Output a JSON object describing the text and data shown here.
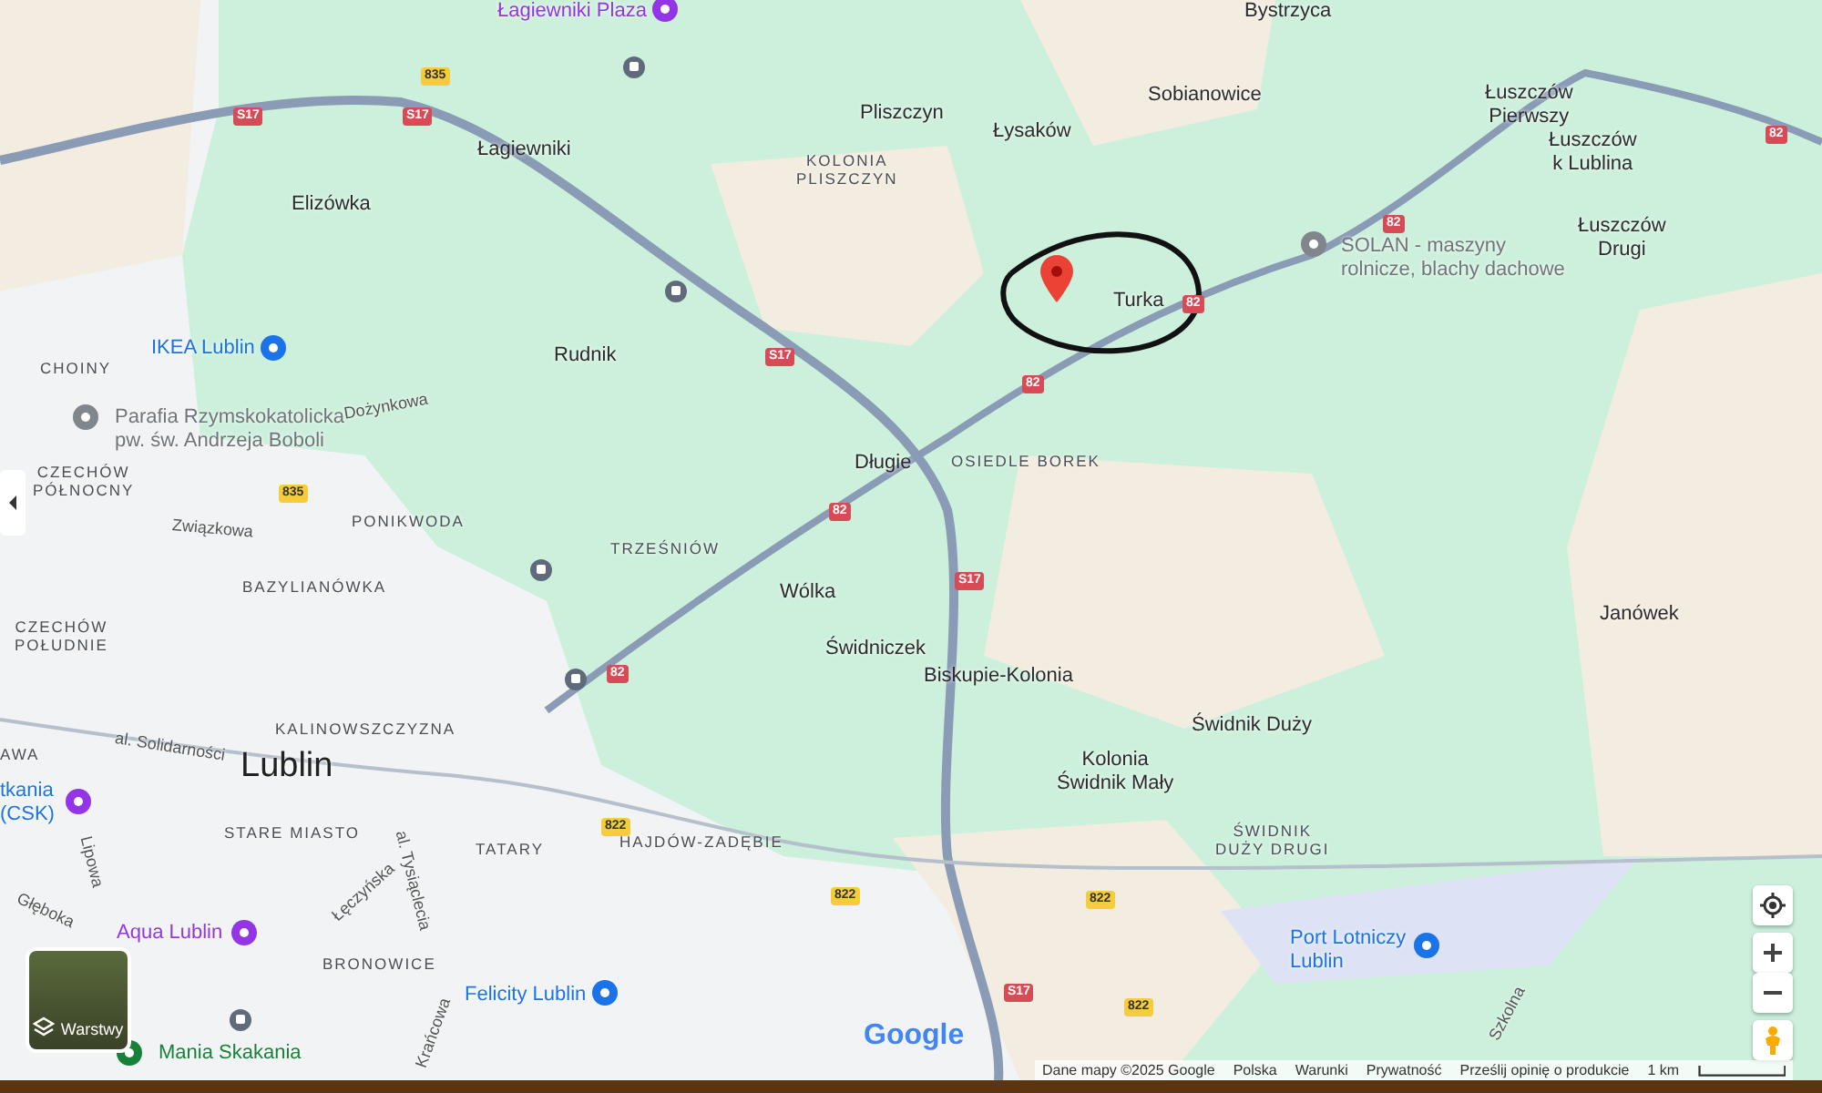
{
  "labels": [
    {
      "text": "Łagiewniki Plaza",
      "kind": "poi",
      "color": "#9334e6"
    },
    {
      "text": "Bystrzyca",
      "kind": "town"
    },
    {
      "text": "Łagiewniki",
      "kind": "town"
    },
    {
      "text": "Pliszczyn",
      "kind": "town"
    },
    {
      "text": "Łysaków",
      "kind": "town"
    },
    {
      "text": "Sobianowice",
      "kind": "town"
    },
    {
      "text": "Łuszczów\nPierwszy",
      "kind": "town"
    },
    {
      "text": "Łuszczów\nk Lublina",
      "kind": "town"
    },
    {
      "text": "KOLONIA\nPLISZCZYN",
      "kind": "district"
    },
    {
      "text": "Elizówka",
      "kind": "town"
    },
    {
      "text": "SOLAN - maszyny\nrolnicze, blachy dachowe",
      "kind": "poi",
      "color": "#70757a"
    },
    {
      "text": "Łuszczów\nDrugi",
      "kind": "town"
    },
    {
      "text": "Turka",
      "kind": "town"
    },
    {
      "text": "IKEA Lublin",
      "kind": "poi",
      "color": "#1a73e8"
    },
    {
      "text": "Rudnik",
      "kind": "town"
    },
    {
      "text": "CHOINY",
      "kind": "district"
    },
    {
      "text": "Parafia Rzymskokatolicka\npw. św. Andrzeja Boboli",
      "kind": "poi",
      "color": "#70757a"
    },
    {
      "text": "Dożynkowa",
      "kind": "street"
    },
    {
      "text": "Długie",
      "kind": "town"
    },
    {
      "text": "OSIEDLE BOREK",
      "kind": "district"
    },
    {
      "text": "CZECHÓW\nPÓŁNOCNY",
      "kind": "district"
    },
    {
      "text": "Związkowa",
      "kind": "street"
    },
    {
      "text": "PONIKWODA",
      "kind": "district"
    },
    {
      "text": "TRZEŚNIÓW",
      "kind": "district"
    },
    {
      "text": "BAZYLIANÓWKA",
      "kind": "district"
    },
    {
      "text": "Wólka",
      "kind": "town"
    },
    {
      "text": "Janówek",
      "kind": "town"
    },
    {
      "text": "CZECHÓW\nPOŁUDNIE",
      "kind": "district"
    },
    {
      "text": "Świdniczek",
      "kind": "town"
    },
    {
      "text": "Biskupie-Kolonia",
      "kind": "town"
    },
    {
      "text": "KALINOWSZCZYZNA",
      "kind": "district"
    },
    {
      "text": "Świdnik Duży",
      "kind": "town"
    },
    {
      "text": "al. Solidarności",
      "kind": "street"
    },
    {
      "text": "AWA",
      "kind": "district"
    },
    {
      "text": "tkania\n(CSK)",
      "kind": "poi",
      "color": "#1a73e8"
    },
    {
      "text": "Lublin",
      "kind": "city"
    },
    {
      "text": "Kolonia\nŚwidnik Mały",
      "kind": "town"
    },
    {
      "text": "STARE MIASTO",
      "kind": "district"
    },
    {
      "text": "al. Tysiąclecia",
      "kind": "street"
    },
    {
      "text": "Lipowa",
      "kind": "street"
    },
    {
      "text": "TATARY",
      "kind": "district"
    },
    {
      "text": "HAJDÓW-ZADĘBIE",
      "kind": "district"
    },
    {
      "text": "ŚWIDNIK\nDUŻY DRUGI",
      "kind": "district"
    },
    {
      "text": "Głęboka",
      "kind": "street"
    },
    {
      "text": "Łęczyńska",
      "kind": "street"
    },
    {
      "text": "Aqua Lublin",
      "kind": "poi",
      "color": "#9334e6"
    },
    {
      "text": "BRONOWICE",
      "kind": "district"
    },
    {
      "text": "Port Lotniczy\nLublin",
      "kind": "poi",
      "color": "#1a73e8"
    },
    {
      "text": "Felicity Lublin",
      "kind": "poi",
      "color": "#1a73e8"
    },
    {
      "text": "Krańcowa",
      "kind": "street"
    },
    {
      "text": "Szkolna",
      "kind": "street"
    },
    {
      "text": "Mania Skakania",
      "kind": "poi",
      "color": "#188038"
    }
  ],
  "road_shields": [
    {
      "text": "835",
      "kind": "regional"
    },
    {
      "text": "S17",
      "kind": "expressway"
    },
    {
      "text": "S17",
      "kind": "expressway"
    },
    {
      "text": "82",
      "kind": "national"
    },
    {
      "text": "82",
      "kind": "national"
    },
    {
      "text": "S17",
      "kind": "expressway"
    },
    {
      "text": "82",
      "kind": "national"
    },
    {
      "text": "82",
      "kind": "national"
    },
    {
      "text": "835",
      "kind": "regional"
    },
    {
      "text": "82",
      "kind": "national"
    },
    {
      "text": "S17",
      "kind": "expressway"
    },
    {
      "text": "82",
      "kind": "national"
    },
    {
      "text": "822",
      "kind": "regional"
    },
    {
      "text": "822",
      "kind": "regional"
    },
    {
      "text": "822",
      "kind": "regional"
    },
    {
      "text": "S17",
      "kind": "expressway"
    },
    {
      "text": "822",
      "kind": "regional"
    }
  ],
  "layers_button": {
    "label": "Warstwy"
  },
  "logo": "Google",
  "footer": {
    "items": [
      "Dane mapy ©2025 Google",
      "Polska",
      "Warunki",
      "Prywatność",
      "Prześlij opinię o produkcie"
    ],
    "scale": "1 km"
  }
}
